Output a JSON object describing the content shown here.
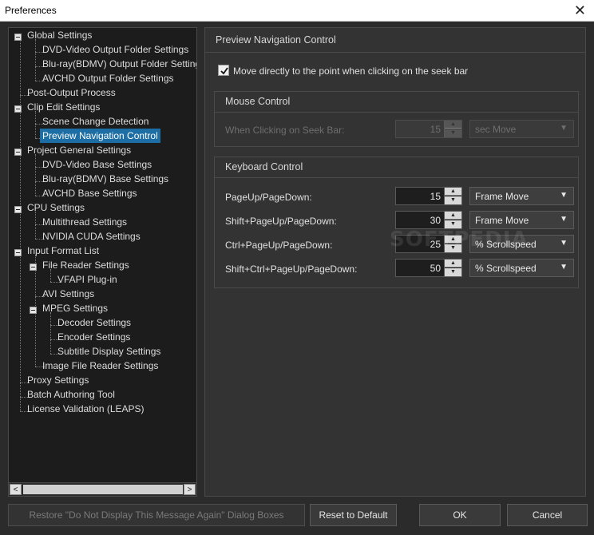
{
  "window": {
    "title": "Preferences",
    "close_glyph": "✕"
  },
  "tree": {
    "items": [
      "Global Settings",
      "DVD-Video Output Folder Settings",
      "Blu-ray(BDMV) Output Folder Settings",
      "AVCHD Output Folder Settings",
      "Post-Output Process",
      "Clip Edit Settings",
      "Scene Change Detection",
      "Preview Navigation Control",
      "Project General Settings",
      "DVD-Video Base Settings",
      "Blu-ray(BDMV) Base Settings",
      "AVCHD Base Settings",
      "CPU Settings",
      "Multithread Settings",
      "NVIDIA CUDA Settings",
      "Input Format List",
      "File Reader Settings",
      "VFAPI Plug-in",
      "AVI Settings",
      "MPEG Settings",
      "Decoder Settings",
      "Encoder Settings",
      "Subtitle Display Settings",
      "Image File Reader Settings",
      "Proxy Settings",
      "Batch Authoring Tool",
      "License Validation (LEAPS)"
    ],
    "selected": "Preview Navigation Control"
  },
  "panel": {
    "title": "Preview Navigation Control",
    "move_directly_label": "Move directly to the point when clicking on the seek bar",
    "move_directly_checked": true
  },
  "mouse_control": {
    "title": "Mouse Control",
    "label": "When Clicking on Seek Bar:",
    "value": "15",
    "unit": "sec Move"
  },
  "keyboard_control": {
    "title": "Keyboard Control",
    "rows": [
      {
        "label": "PageUp/PageDown:",
        "value": "15",
        "unit": "Frame Move"
      },
      {
        "label": "Shift+PageUp/PageDown:",
        "value": "30",
        "unit": "Frame Move"
      },
      {
        "label": "Ctrl+PageUp/PageDown:",
        "value": "25",
        "unit": "% Scrollspeed"
      },
      {
        "label": "Shift+Ctrl+PageUp/PageDown:",
        "value": "50",
        "unit": "% Scrollspeed"
      }
    ]
  },
  "watermark": "SOFTPEDIA",
  "buttons": {
    "restore": "Restore \"Do Not Display This Message Again\" Dialog Boxes",
    "reset": "Reset to Default",
    "ok": "OK",
    "cancel": "Cancel"
  },
  "icons": {
    "check": "check-icon",
    "caret": "▼",
    "spin_up": "▲",
    "spin_down": "▼",
    "scroll_left": "<",
    "scroll_right": ">"
  }
}
